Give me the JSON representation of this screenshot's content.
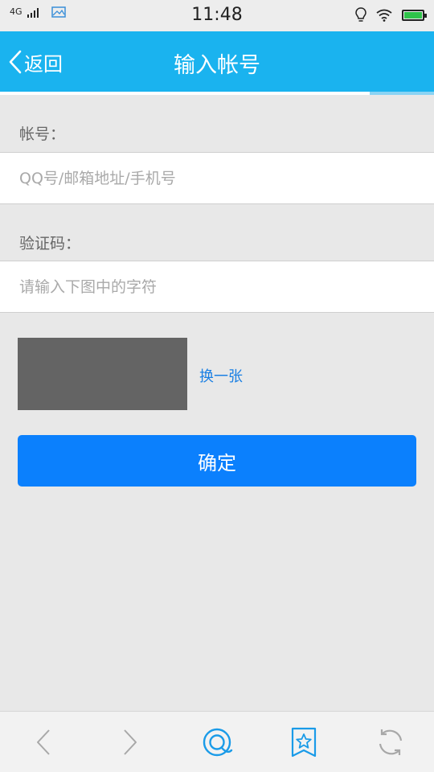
{
  "status_bar": {
    "network": "4G",
    "time": "11:48",
    "icons": [
      "signal-icon",
      "gallery-icon",
      "bulb-icon",
      "wifi-icon",
      "battery-icon"
    ],
    "battery_color": "#2fc34a"
  },
  "header": {
    "back_label": "返回",
    "title": "输入帐号",
    "background": "#1ab3ef"
  },
  "form": {
    "account": {
      "label": "帐号：",
      "placeholder": "QQ号/邮箱地址/手机号",
      "value": ""
    },
    "captcha": {
      "label": "验证码：",
      "placeholder": "请输入下图中的字符",
      "value": ""
    },
    "refresh_label": "换一张",
    "confirm_label": "确定",
    "confirm_color": "#0b80fd"
  },
  "bottom_nav": {
    "icons": [
      "back-arrow-icon",
      "forward-arrow-icon",
      "browser-home-icon",
      "bookmark-icon",
      "refresh-icon"
    ]
  }
}
